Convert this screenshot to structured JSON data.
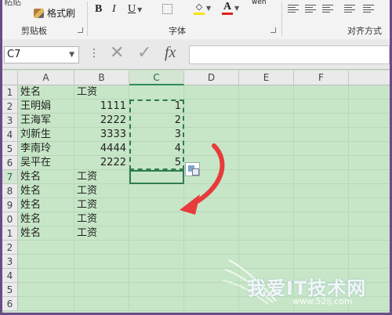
{
  "ribbon": {
    "top_cut_label": "粘贴",
    "format_painter_label": "格式刷",
    "bold_label": "B",
    "italic_label": "I",
    "underline_label": "U",
    "wen_label": "wén",
    "groups": {
      "clipboard": "剪贴板",
      "font": "字体",
      "alignment": "对齐方式"
    }
  },
  "formula_bar": {
    "name_box": "C7",
    "value": ""
  },
  "columns": [
    "A",
    "B",
    "C",
    "D",
    "E",
    "F"
  ],
  "rows": [
    "1",
    "2",
    "3",
    "4",
    "5",
    "6",
    "7",
    "8",
    "9",
    "0",
    "1",
    "2",
    "3",
    "4",
    "5",
    "6"
  ],
  "cells": {
    "A": [
      "姓名",
      "王明娟",
      "王海军",
      "刘新生",
      "李南玲",
      "吴平在",
      "姓名",
      "姓名",
      "姓名",
      "姓名",
      "姓名",
      "",
      "",
      "",
      "",
      ""
    ],
    "B": [
      "工资",
      "1111",
      "2222",
      "3333",
      "4444",
      "2222",
      "工资",
      "工资",
      "工资",
      "工资",
      "工资",
      "",
      "",
      "",
      "",
      ""
    ],
    "C": [
      "",
      "1",
      "2",
      "3",
      "4",
      "5",
      "",
      "",
      "",
      "",
      "",
      "",
      "",
      "",
      "",
      ""
    ]
  },
  "watermark": {
    "main": "我爱IT技术网",
    "url": "www.52ij.com"
  },
  "colors": {
    "sheet_bg": "#c7e6c7",
    "accent": "#2e7d4f",
    "arrow": "#e83b3b"
  }
}
